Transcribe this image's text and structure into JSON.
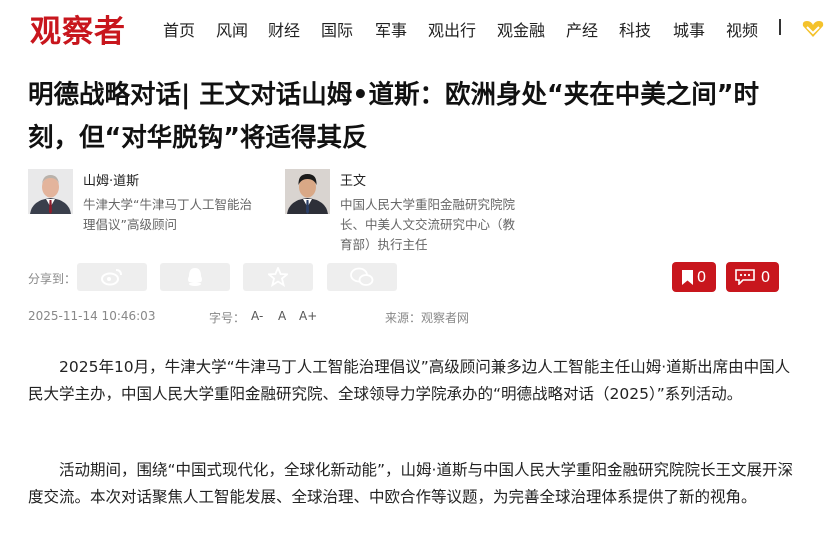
{
  "nav": {
    "logo": "观察者",
    "items": [
      "首页",
      "风闻",
      "财经",
      "国际",
      "军事",
      "观出行",
      "观金融",
      "产经",
      "科技",
      "城事",
      "视频"
    ],
    "vip_icon": "gold-heart-icon"
  },
  "article": {
    "title": "明德战略对话| 王文对话山姆•道斯：欧洲身处“夹在中美之间”时刻，但“对华脱钩”将适得其反",
    "authors": [
      {
        "name": "山姆·道斯",
        "desc": "牛津大学“牛津马丁人工智能治理倡议”高级顾问"
      },
      {
        "name": "王文",
        "desc": "中国人民大学重阳金融研究院院长、中美人文交流研究中心（教育部）执行主任"
      }
    ],
    "share_label": "分享到：",
    "share_icons": [
      "weibo-icon",
      "qq-icon",
      "star-icon",
      "wechat-icon"
    ],
    "bookmark_count": "0",
    "comment_count": "0",
    "date": "2025-11-14 10:46:03",
    "font_size_label": "字号：",
    "font_sizes": [
      "A-",
      "A",
      "A+"
    ],
    "source": "来源：观察者网",
    "paragraphs": [
      "2025年10月，牛津大学“牛津马丁人工智能治理倡议”高级顾问兼多边人工智能主任山姆·道斯出席由中国人民大学主办，中国人民大学重阳金融研究院、全球领导力学院承办的“明德战略对话（2025）”系列活动。",
      "活动期间，围绕“中国式现代化，全球化新动能”，山姆·道斯与中国人民大学重阳金融研究院院长王文展开深度交流。本次对话聚焦人工智能发展、全球治理、中欧合作等议题，为完善全球治理体系提供了新的视角。"
    ]
  },
  "colors": {
    "brand": "#c8161d",
    "muted": "#888888",
    "button_bg": "#eeeeee"
  }
}
